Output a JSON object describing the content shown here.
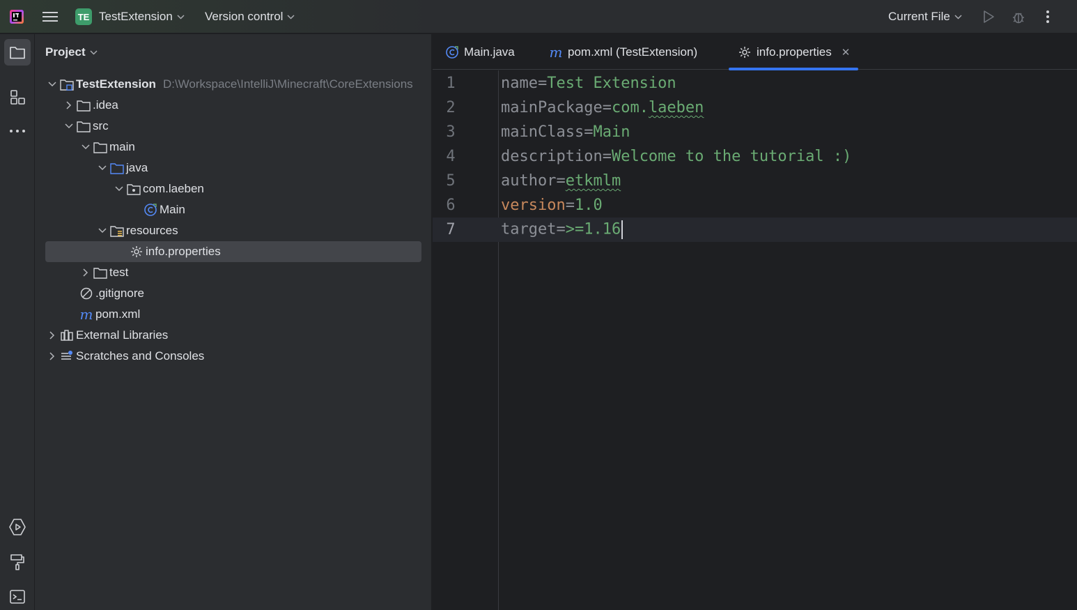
{
  "titlebar": {
    "project_badge": "TE",
    "project_name": "TestExtension",
    "vcs": "Version control",
    "run_config": "Current File"
  },
  "project_panel": {
    "title": "Project",
    "tree": [
      {
        "label": "TestExtension",
        "hint": "D:\\Workspace\\IntelliJ\\Minecraft\\CoreExtensions",
        "icon": "module-folder-icon"
      },
      {
        "label": ".idea",
        "icon": "folder-icon"
      },
      {
        "label": "src",
        "icon": "folder-icon"
      },
      {
        "label": "main",
        "icon": "folder-icon"
      },
      {
        "label": "java",
        "icon": "source-folder-icon"
      },
      {
        "label": "com.laeben",
        "icon": "package-icon"
      },
      {
        "label": "Main",
        "icon": "java-class-icon"
      },
      {
        "label": "resources",
        "icon": "resources-folder-icon"
      },
      {
        "label": "info.properties",
        "icon": "properties-file-icon"
      },
      {
        "label": "test",
        "icon": "folder-icon"
      },
      {
        "label": ".gitignore",
        "icon": "gitignore-icon"
      },
      {
        "label": "pom.xml",
        "icon": "maven-icon"
      },
      {
        "label": "External Libraries",
        "icon": "libraries-icon"
      },
      {
        "label": "Scratches and Consoles",
        "icon": "scratches-icon"
      }
    ]
  },
  "editor": {
    "tabs": [
      {
        "label": "Main.java",
        "icon": "java-class-icon"
      },
      {
        "label": "pom.xml (TestExtension)",
        "icon": "maven-icon"
      },
      {
        "label": "info.properties",
        "icon": "properties-file-icon"
      }
    ],
    "lines": [
      {
        "no": "1",
        "key": "name",
        "eq": "=",
        "value": "Test Extension"
      },
      {
        "no": "2",
        "key": "mainPackage",
        "eq": "=",
        "value_a": "com.",
        "value_b": "laeben"
      },
      {
        "no": "3",
        "key": "mainClass",
        "eq": "=",
        "value": "Main"
      },
      {
        "no": "4",
        "key": "description",
        "eq": "=",
        "value": "Welcome to the tutorial :)"
      },
      {
        "no": "5",
        "key": "author",
        "eq": "=",
        "value": "etkmlm"
      },
      {
        "no": "6",
        "key": "version",
        "eq": "=",
        "value": "1.0"
      },
      {
        "no": "7",
        "key": "target",
        "eq": "=",
        "value": ">=1.16"
      }
    ]
  }
}
